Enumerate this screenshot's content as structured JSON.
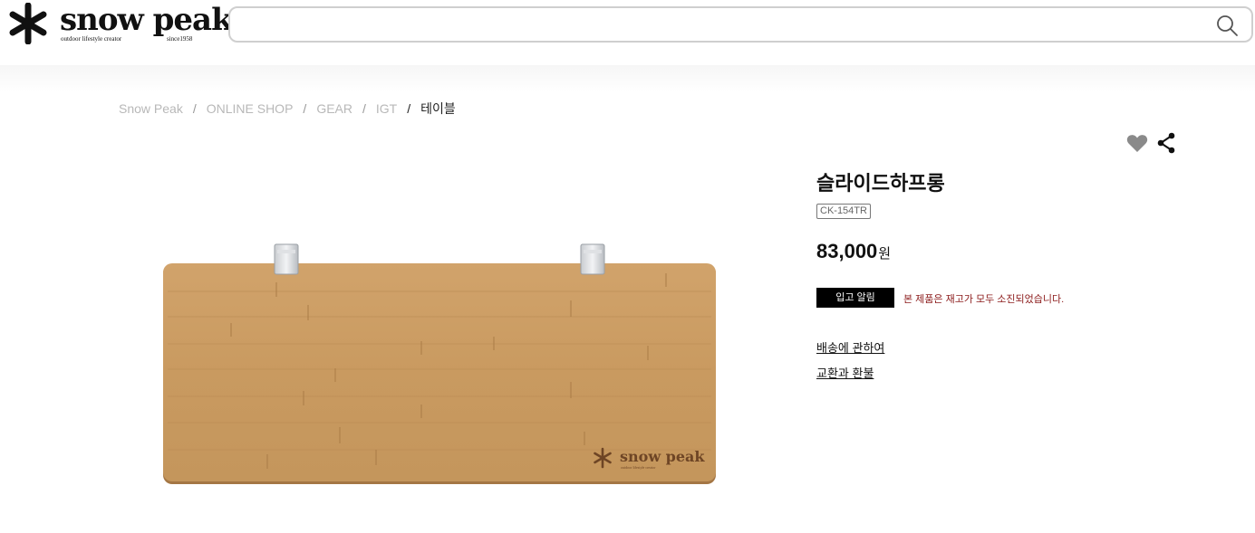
{
  "header": {
    "logo": {
      "wordmark": "snow peak",
      "tagline": "outdoor lifestyle creator",
      "since": "since1958"
    },
    "search": {
      "value": "",
      "placeholder": "",
      "icon": "search-icon"
    }
  },
  "breadcrumb": {
    "items": [
      "Snow Peak",
      "ONLINE SHOP",
      "GEAR",
      "IGT"
    ],
    "separator": "/",
    "current": "테이블"
  },
  "product": {
    "image_brand": "snow peak",
    "image_brand_tagline": "outdoor lifestyle creator",
    "name": "슬라이드하프롱",
    "code": "CK-154TR",
    "price": "83,000",
    "currency": "원",
    "restock_button": "입고 알림",
    "stock_message": "본 제품은 재고가 모두 소진되었습니다.",
    "links": {
      "shipping": "배송에 관하여",
      "exchange": "교환과 환불"
    },
    "actions": {
      "favorite_icon": "heart-icon",
      "share_icon": "share-icon"
    }
  },
  "colors": {
    "stock_message": "#8b1a1a",
    "button_bg": "#000000",
    "wood": "#c9995f",
    "icon_gray": "#8a8a8a"
  }
}
